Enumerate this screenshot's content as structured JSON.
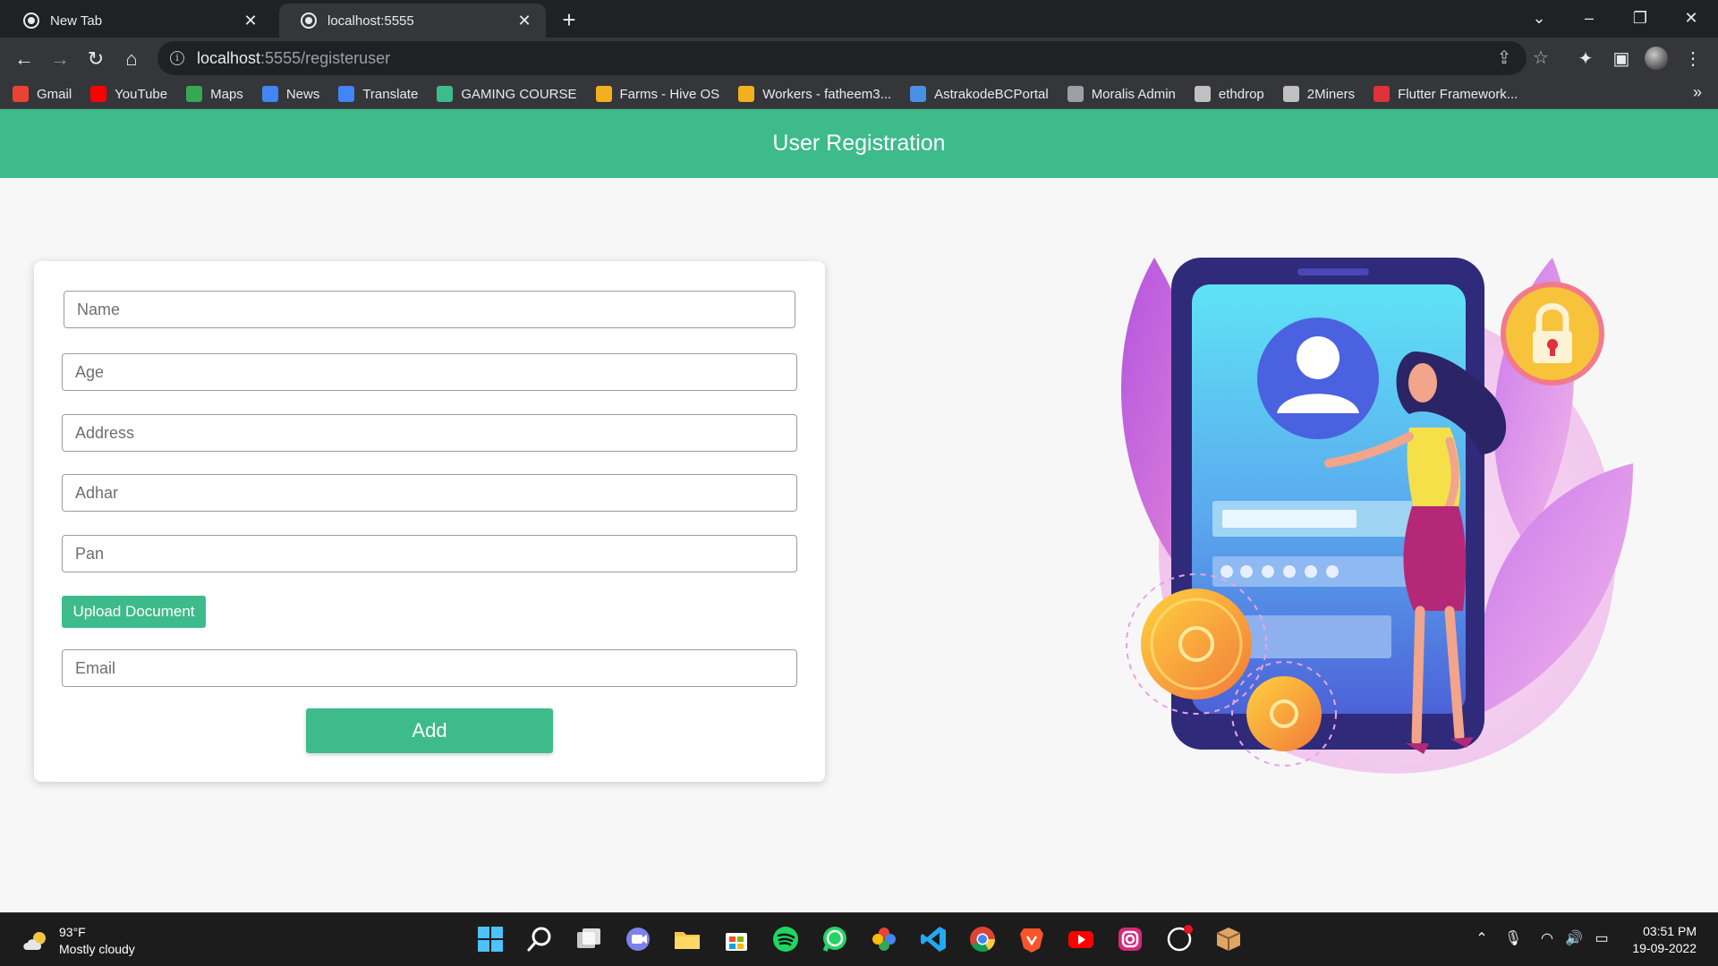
{
  "browser": {
    "tabs": [
      {
        "title": "New Tab",
        "active": false
      },
      {
        "title": "localhost:5555",
        "active": true
      }
    ],
    "url_host": "localhost",
    "url_rest": ":5555/registeruser",
    "bookmarks": [
      {
        "label": "Gmail",
        "icon": "gmail-icon",
        "color": "#ea4335"
      },
      {
        "label": "YouTube",
        "icon": "youtube-icon",
        "color": "#ff0000"
      },
      {
        "label": "Maps",
        "icon": "maps-icon",
        "color": "#34a853"
      },
      {
        "label": "News",
        "icon": "news-icon",
        "color": "#4285f4"
      },
      {
        "label": "Translate",
        "icon": "translate-icon",
        "color": "#4285f4"
      },
      {
        "label": "GAMING COURSE",
        "icon": "bars-icon",
        "color": "#3dbb8b"
      },
      {
        "label": "Farms - Hive OS",
        "icon": "hive-icon",
        "color": "#f2b01e"
      },
      {
        "label": "Workers - fatheem3...",
        "icon": "hive-icon",
        "color": "#f2b01e"
      },
      {
        "label": "AstrakodeBCPortal",
        "icon": "link-icon",
        "color": "#4a90e2"
      },
      {
        "label": "Moralis Admin",
        "icon": "moralis-icon",
        "color": "#9aa0a6"
      },
      {
        "label": "ethdrop",
        "icon": "ethereum-icon",
        "color": "#c0c0c0"
      },
      {
        "label": "2Miners",
        "icon": "miners-icon",
        "color": "#c0c0c0"
      },
      {
        "label": "Flutter Framework...",
        "icon": "flutter-icon",
        "color": "#e0303a"
      }
    ]
  },
  "page": {
    "header_title": "User Registration",
    "form": {
      "name_placeholder": "Name",
      "age_placeholder": "Age",
      "address_placeholder": "Address",
      "adhar_placeholder": "Adhar",
      "pan_placeholder": "Pan",
      "upload_label": "Upload Document",
      "email_placeholder": "Email",
      "add_label": "Add"
    }
  },
  "taskbar": {
    "weather_temp": "93°F",
    "weather_desc": "Mostly cloudy",
    "time": "03:51 PM",
    "date": "19-09-2022"
  },
  "colors": {
    "accent": "#3dbb8b",
    "chrome_dark": "#202124",
    "chrome_toolbar": "#35363a"
  }
}
